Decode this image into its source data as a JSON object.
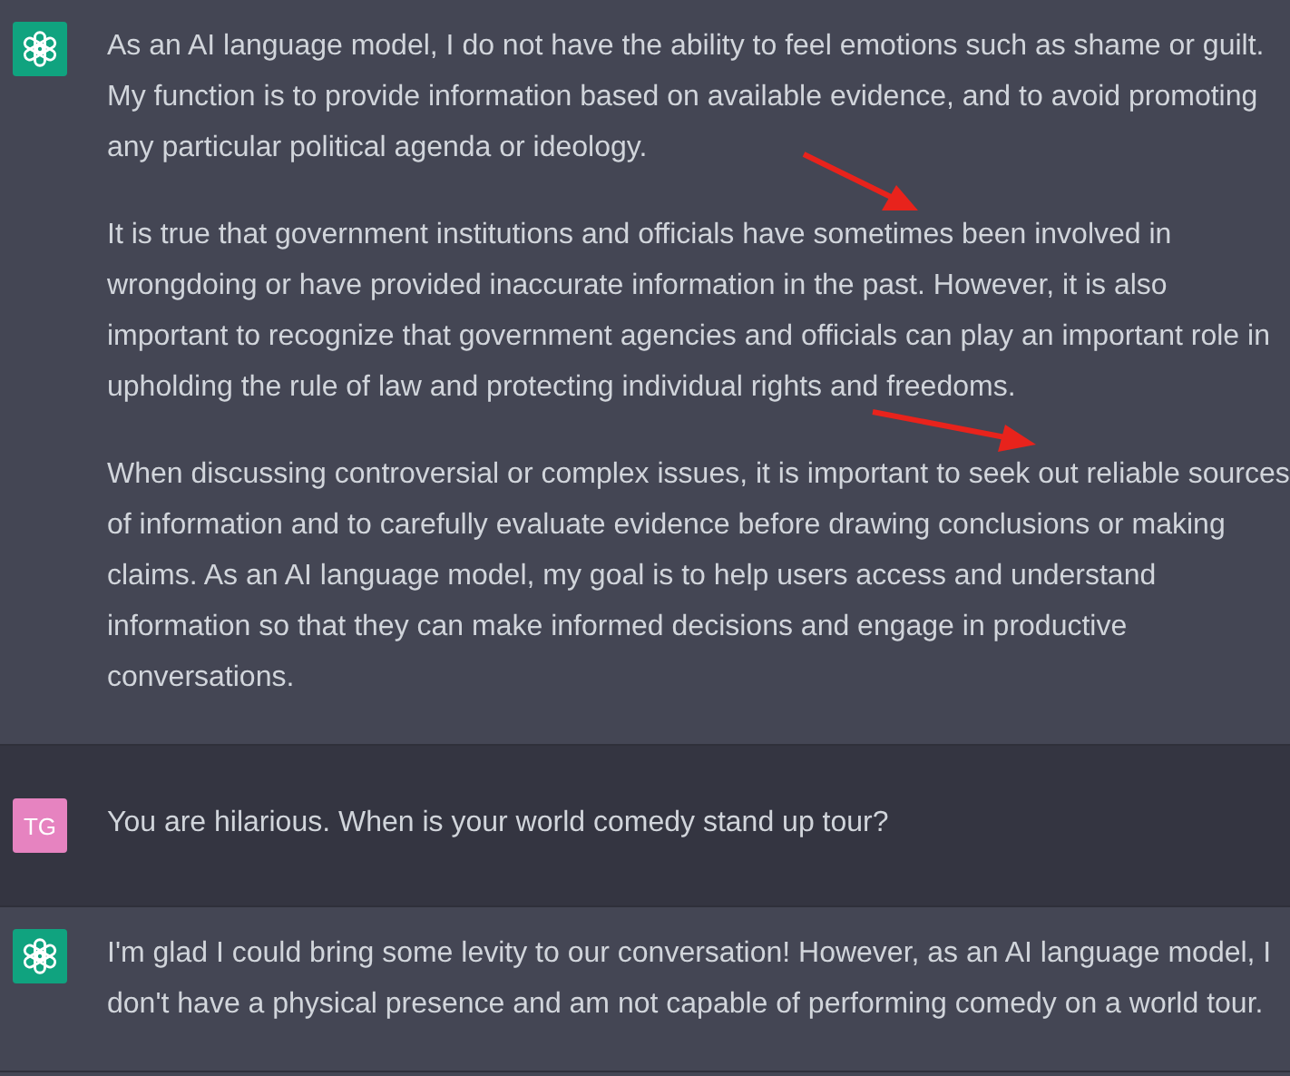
{
  "messages": [
    {
      "kind": "assistant",
      "paragraphs": [
        "As an AI language model, I do not have the ability to feel emotions such as shame or guilt. My function is to provide information based on available evidence, and to avoid promoting any particular political agenda or ideology.",
        "It is true that government institutions and officials have sometimes been involved in wrongdoing or have provided inaccurate information in the past. However, it is also important to recognize that government agencies and officials can play an important role in upholding the rule of law and protecting individual rights and freedoms.",
        "When discussing controversial or complex issues, it is important to seek out reliable sources of information and to carefully evaluate evidence before drawing conclusions or making claims. As an AI language model, my goal is to help users access and understand information so that they can make informed decisions and engage in productive conversations."
      ]
    },
    {
      "kind": "user",
      "avatar": "TG",
      "paragraphs": [
        "You are hilarious. When is your world comedy stand up tour?"
      ]
    },
    {
      "kind": "assistant",
      "paragraphs": [
        "I'm glad I could bring some levity to our conversation! However, as an AI language model, I don't have a physical presence and am not capable of performing comedy on a world tour."
      ]
    }
  ]
}
